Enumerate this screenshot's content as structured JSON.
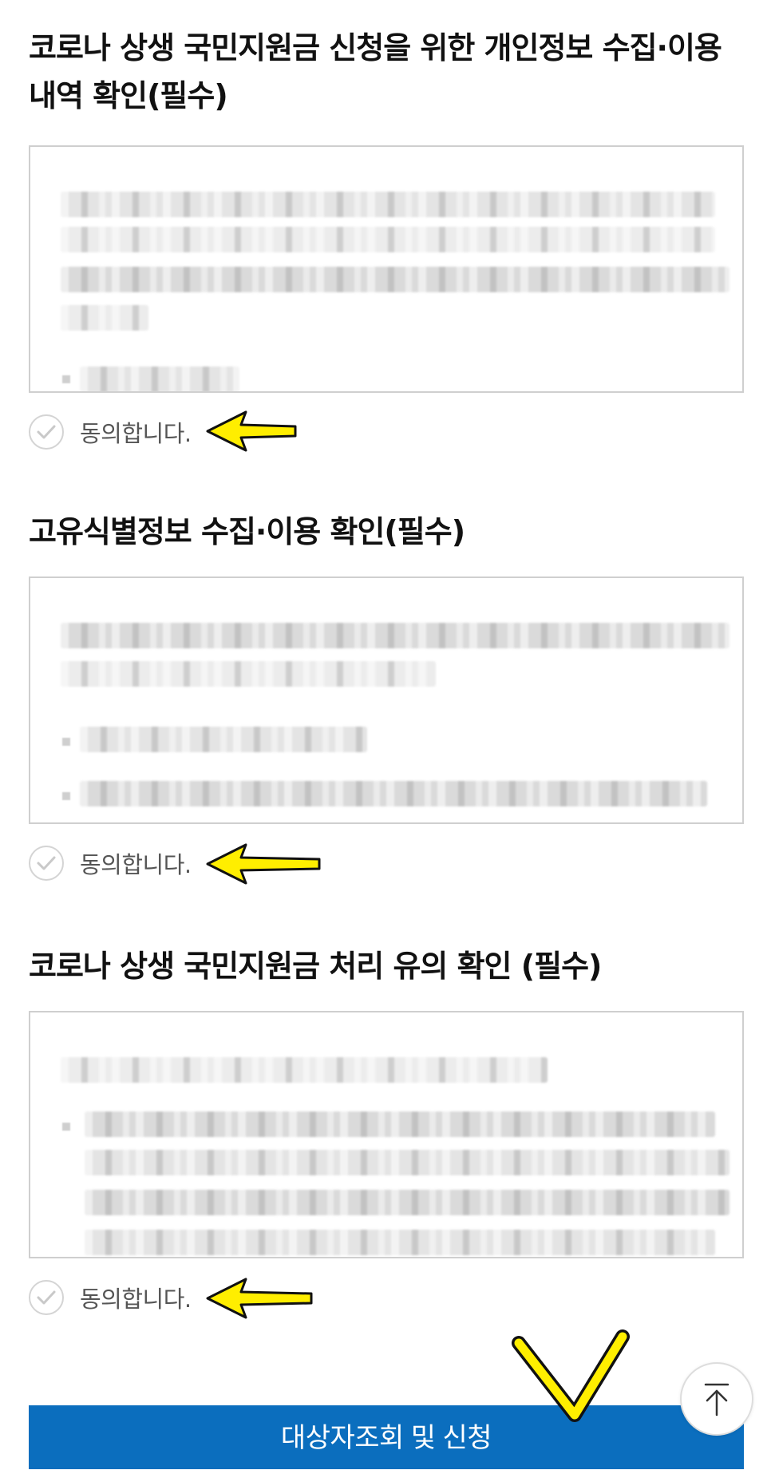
{
  "sections": [
    {
      "title": "코로나 상생 국민지원금 신청을 위한 개인정보 수집·이용 내역 확인(필수)",
      "agree_label": "동의합니다."
    },
    {
      "title": "고유식별정보 수집·이용 확인(필수)",
      "agree_label": "동의합니다."
    },
    {
      "title": "코로나 상생 국민지원금 처리 유의 확인 (필수)",
      "agree_label": "동의합니다."
    }
  ],
  "submit_button": {
    "label": "대상자조회 및 신청"
  },
  "icons": {
    "check": "check-circle-icon",
    "arrow": "yellow-arrow-left-icon",
    "scroll_top": "arrow-up-icon"
  },
  "colors": {
    "button_blue": "#0b6ebe",
    "annotation_yellow": "#ffee00",
    "border_gray": "#cfcfcf"
  }
}
